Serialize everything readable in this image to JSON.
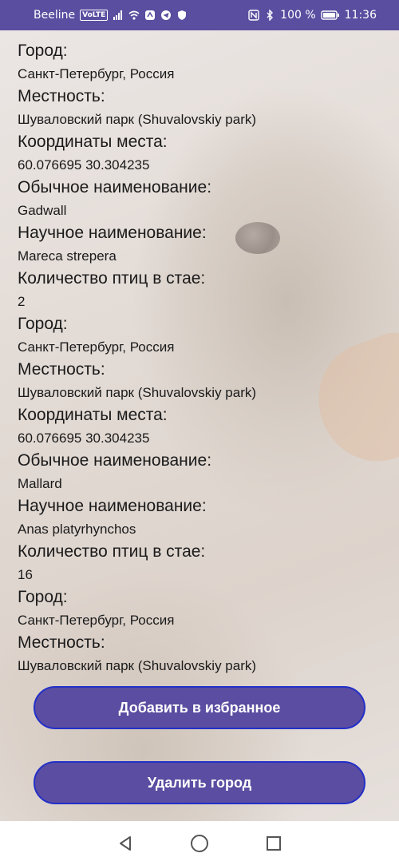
{
  "status_bar": {
    "carrier": "Beeline",
    "volte": "VoLTE",
    "battery": "100 %",
    "time": "11:36"
  },
  "records": [
    {
      "label": "Город:",
      "value": "Санкт-Петербург, Россия"
    },
    {
      "label": "Местность:",
      "value": "Шуваловский парк (Shuvalovskiy park)"
    },
    {
      "label": "Координаты места:",
      "value": "60.076695 30.304235"
    },
    {
      "label": "Обычное наименование:",
      "value": "Gadwall"
    },
    {
      "label": "Научное наименование:",
      "value": "Mareca strepera"
    },
    {
      "label": "Количество птиц в стае:",
      "value": "2"
    },
    {
      "label": "Город:",
      "value": "Санкт-Петербург, Россия"
    },
    {
      "label": "Местность:",
      "value": "Шуваловский парк (Shuvalovskiy park)"
    },
    {
      "label": "Координаты места:",
      "value": "60.076695 30.304235"
    },
    {
      "label": "Обычное наименование:",
      "value": "Mallard"
    },
    {
      "label": "Научное наименование:",
      "value": "Anas platyrhynchos"
    },
    {
      "label": "Количество птиц в стае:",
      "value": "16"
    },
    {
      "label": "Город:",
      "value": "Санкт-Петербург, Россия"
    },
    {
      "label": "Местность:",
      "value": "Шуваловский парк (Shuvalovskiy park)"
    }
  ],
  "buttons": {
    "add_favorite": "Добавить в избранное",
    "delete_city": "Удалить город"
  },
  "colors": {
    "accent": "#5b4da1",
    "button_border": "#2330c8",
    "status_bar": "#5a4ea0"
  }
}
